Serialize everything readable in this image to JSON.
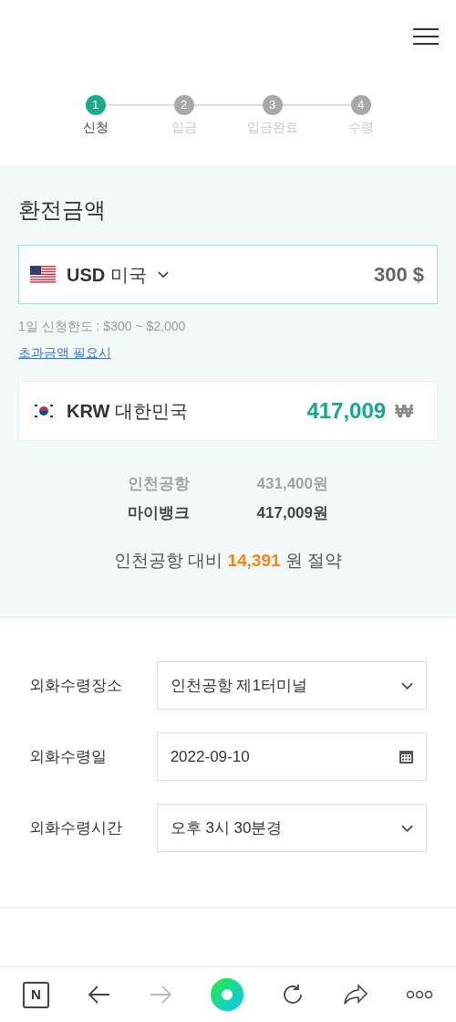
{
  "steps": [
    {
      "number": "1",
      "label": "신청",
      "selected": true
    },
    {
      "number": "2",
      "label": "입금",
      "selected": false
    },
    {
      "number": "3",
      "label": "입금완료",
      "selected": false
    },
    {
      "number": "4",
      "label": "수령",
      "selected": false
    }
  ],
  "exchange": {
    "title": "환전금액",
    "from": {
      "code": "USD",
      "country": "미국",
      "amount": "300",
      "unit": "$"
    },
    "limit_note": "1일 신청한도 : $300 ~ $2,000",
    "link": "초과금액 필요시",
    "to": {
      "code": "KRW",
      "country": "대한민국",
      "amount": "417,009",
      "unit": "₩"
    },
    "comparison": [
      {
        "name": "인천공항",
        "price": "431,400원",
        "highlight": false
      },
      {
        "name": "마이뱅크",
        "price": "417,009원",
        "highlight": true
      }
    ],
    "savings": "인천공항 대비 **14,391** 원 절약"
  },
  "form": [
    {
      "label": "외화수령장소",
      "value": "인천공항 제1터미널",
      "kind": "select"
    },
    {
      "label": "외화수령일",
      "value": "2022-09-10",
      "kind": "date"
    },
    {
      "label": "외화수령시간",
      "value": "오후 3시 30분경",
      "kind": "select"
    }
  ],
  "toolbar": {
    "logo": "N"
  }
}
